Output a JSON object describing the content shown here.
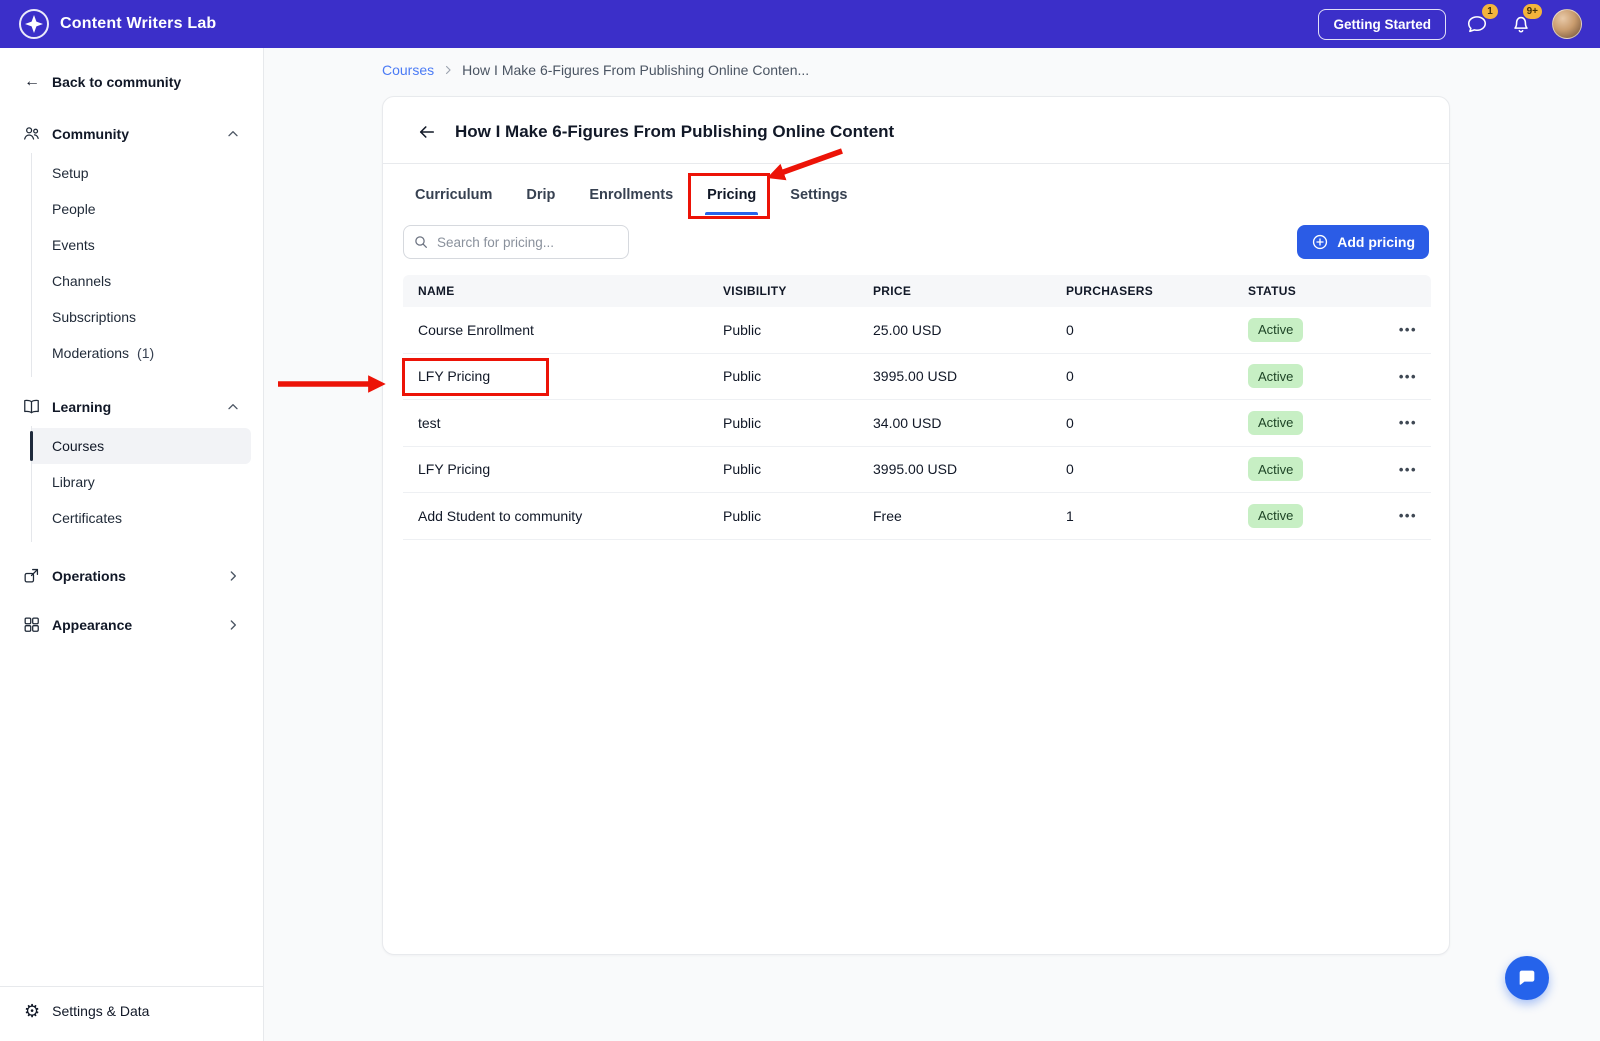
{
  "topbar": {
    "brand": "Content Writers Lab",
    "getting_started_label": "Getting Started",
    "chat_badge": "1",
    "notifications_badge": "9+"
  },
  "sidebar": {
    "back_label": "Back to community",
    "community": {
      "label": "Community",
      "items": [
        {
          "label": "Setup"
        },
        {
          "label": "People"
        },
        {
          "label": "Events"
        },
        {
          "label": "Channels"
        },
        {
          "label": "Subscriptions"
        },
        {
          "label": "Moderations",
          "count": "(1)"
        }
      ]
    },
    "learning": {
      "label": "Learning",
      "items": [
        {
          "label": "Courses",
          "selected": true
        },
        {
          "label": "Library"
        },
        {
          "label": "Certificates"
        }
      ]
    },
    "operations_label": "Operations",
    "appearance_label": "Appearance",
    "settings_label": "Settings & Data"
  },
  "breadcrumb": {
    "root": "Courses",
    "current": "How I Make 6-Figures From Publishing Online Conten..."
  },
  "course": {
    "title": "How I Make 6-Figures From Publishing Online Content"
  },
  "tabs": [
    "Curriculum",
    "Drip",
    "Enrollments",
    "Pricing",
    "Settings"
  ],
  "active_tab": "Pricing",
  "pricing": {
    "search_placeholder": "Search for pricing...",
    "add_button_label": "Add pricing",
    "table": {
      "columns": [
        "NAME",
        "VISIBILITY",
        "PRICE",
        "PURCHASERS",
        "STATUS"
      ],
      "rows": [
        {
          "name": "Course Enrollment",
          "visibility": "Public",
          "price": "25.00 USD",
          "purchasers": "0",
          "status": "Active"
        },
        {
          "name": "LFY Pricing",
          "visibility": "Public",
          "price": "3995.00 USD",
          "purchasers": "0",
          "status": "Active"
        },
        {
          "name": "test",
          "visibility": "Public",
          "price": "34.00 USD",
          "purchasers": "0",
          "status": "Active"
        },
        {
          "name": "LFY Pricing",
          "visibility": "Public",
          "price": "3995.00 USD",
          "purchasers": "0",
          "status": "Active"
        },
        {
          "name": "Add Student to community",
          "visibility": "Public",
          "price": "Free",
          "purchasers": "1",
          "status": "Active"
        }
      ]
    }
  },
  "icons": {
    "row_menu": "•••",
    "gear": "⚙",
    "back_arrow": "←"
  },
  "colors": {
    "topbar_bg": "#3b2fc9",
    "primary_blue": "#2b5ce6",
    "link_blue": "#4b7bf5",
    "status_active_bg": "#c7efc4",
    "status_active_text": "#1e4426",
    "notification_yellow": "#f3b43c",
    "annotation_red": "#ec1307"
  }
}
